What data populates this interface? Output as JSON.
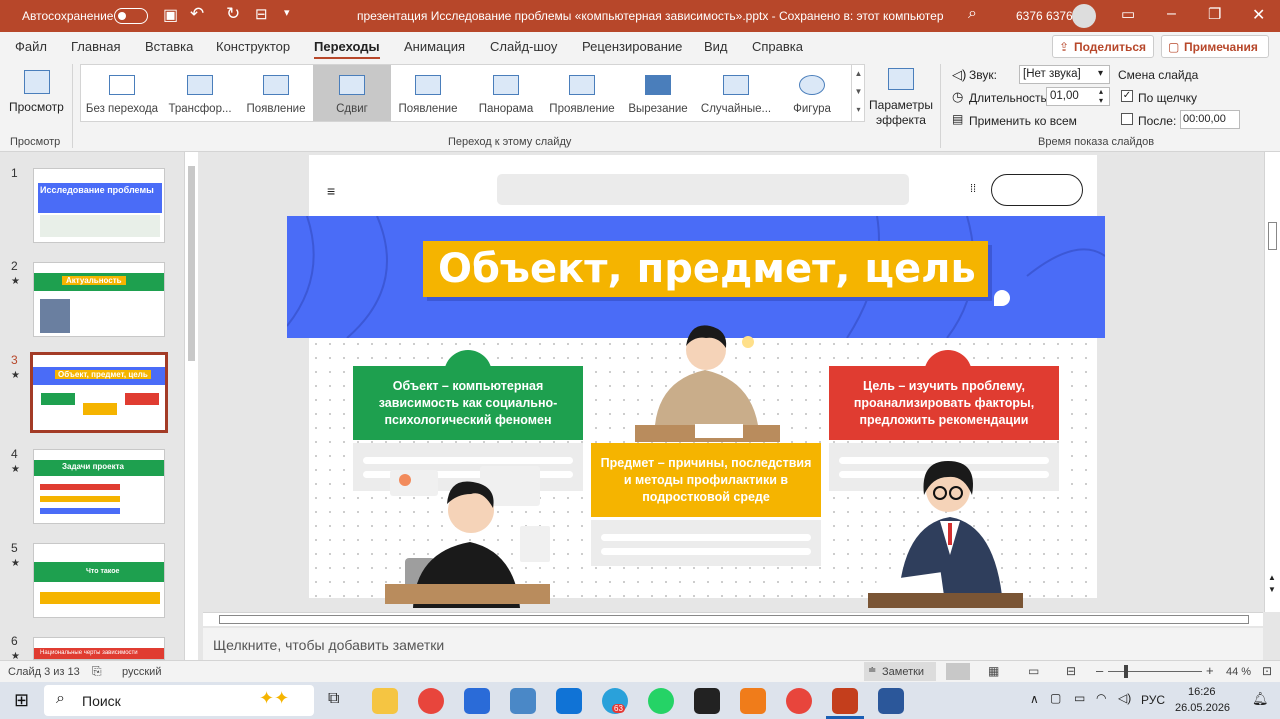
{
  "titlebar": {
    "autosave": "Автосохранение",
    "doc_title": "презентация Исследование проблемы «компьютерная зависимость».pptx  -  Сохранено в: этот компьютер",
    "user": "6376 6376"
  },
  "tabs": [
    "Файл",
    "Главная",
    "Вставка",
    "Конструктор",
    "Переходы",
    "Анимация",
    "Слайд-шоу",
    "Рецензирование",
    "Вид",
    "Справка"
  ],
  "active_tab": "Переходы",
  "share_label": "Поделиться",
  "comments_label": "Примечания",
  "ribbon": {
    "preview_label": "Просмотр",
    "preview_group": "Просмотр",
    "transitions": [
      "Без перехода",
      "Трансфор...",
      "Появление",
      "Сдвиг",
      "Появление",
      "Панорама",
      "Проявление",
      "Вырезание",
      "Случайные...",
      "Фигура"
    ],
    "selected_transition": "Сдвиг",
    "effect_params": "Параметры эффекта",
    "transition_group": "Переход к этому слайду",
    "sound_label": "Звук:",
    "sound_value": "[Нет звука]",
    "duration_label": "Длительность:",
    "duration_value": "01,00",
    "apply_all": "Применить ко всем",
    "advance_label": "Смена слайда",
    "on_click": "По щелчку",
    "after_label": "После:",
    "after_value": "00:00,00",
    "timing_group": "Время показа слайдов"
  },
  "thumbnails": [
    {
      "num": "1",
      "star": "",
      "title": "Исследование проблемы",
      "color": "#4a6cf7"
    },
    {
      "num": "2",
      "star": "★",
      "title": "Актуальность",
      "color": "#1ea04f"
    },
    {
      "num": "3",
      "star": "★",
      "title": "Объект, предмет, цель",
      "color": "#4a6cf7"
    },
    {
      "num": "4",
      "star": "★",
      "title": "Задачи проекта",
      "color": "#1ea04f"
    },
    {
      "num": "5",
      "star": "★",
      "title": "Что такое",
      "color": "#1ea04f"
    },
    {
      "num": "6",
      "star": "★",
      "title": "Национальные черты зависимости",
      "color": "#e03c31"
    }
  ],
  "slide": {
    "title": "Объект, предмет, цель",
    "card_object": "Объект – компьютерная зависимость как социально-психологический феномен",
    "card_subject": "Предмет – причины, последствия и методы профилактики в подростковой среде",
    "card_goal": "Цель – изучить проблему, проанализировать факторы, предложить рекомендации",
    "colors": {
      "banner": "#4a6cf7",
      "title_bg": "#f5b400",
      "green": "#1ea04f",
      "yellow": "#f5b400",
      "red": "#e03c31"
    }
  },
  "notes_placeholder": "Щелкните, чтобы добавить заметки",
  "status": {
    "slide_info": "Слайд 3 из 13",
    "language": "русский",
    "notes": "Заметки",
    "zoom": "44 %"
  },
  "taskbar": {
    "search": "Поиск",
    "lang": "РУС",
    "time": "16:26",
    "date": "26.05.2026",
    "badge": "63"
  }
}
